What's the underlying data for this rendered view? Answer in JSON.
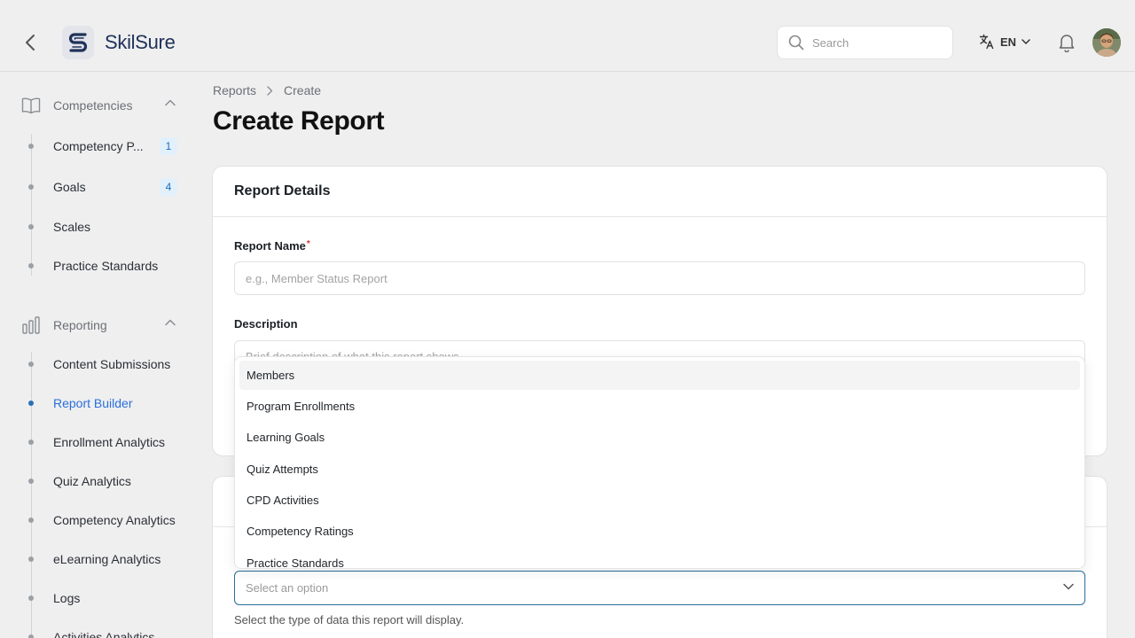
{
  "app": {
    "brand": "SkilSure",
    "accent": "#2a6fb8"
  },
  "header": {
    "search_placeholder": "Search",
    "language": "EN"
  },
  "sidebar": {
    "groups": [
      {
        "label": "Competencies",
        "icon": "book-open-icon",
        "items": [
          {
            "label": "Competency P...",
            "badge": "1"
          },
          {
            "label": "Goals",
            "badge": "4"
          },
          {
            "label": "Scales"
          },
          {
            "label": "Practice Standards"
          }
        ]
      },
      {
        "label": "Reporting",
        "icon": "bar-chart-icon",
        "items": [
          {
            "label": "Content Submissions"
          },
          {
            "label": "Report Builder",
            "active": true
          },
          {
            "label": "Enrollment Analytics"
          },
          {
            "label": "Quiz Analytics"
          },
          {
            "label": "Competency Analytics"
          },
          {
            "label": "eLearning Analytics"
          },
          {
            "label": "Logs"
          },
          {
            "label": "Activities Analytics"
          }
        ]
      }
    ]
  },
  "breadcrumb": [
    "Reports",
    "Create"
  ],
  "page_title": "Create Report",
  "report_details": {
    "title": "Report Details",
    "name_label": "Report Name",
    "name_placeholder": "e.g., Member Status Report",
    "description_label": "Description",
    "description_placeholder": "Brief description of what this report shows"
  },
  "data_source": {
    "select_placeholder": "Select an option",
    "help": "Select the type of data this report will display.",
    "options": [
      "Members",
      "Program Enrollments",
      "Learning Goals",
      "Quiz Attempts",
      "CPD Activities",
      "Competency Ratings",
      "Practice Standards"
    ]
  }
}
